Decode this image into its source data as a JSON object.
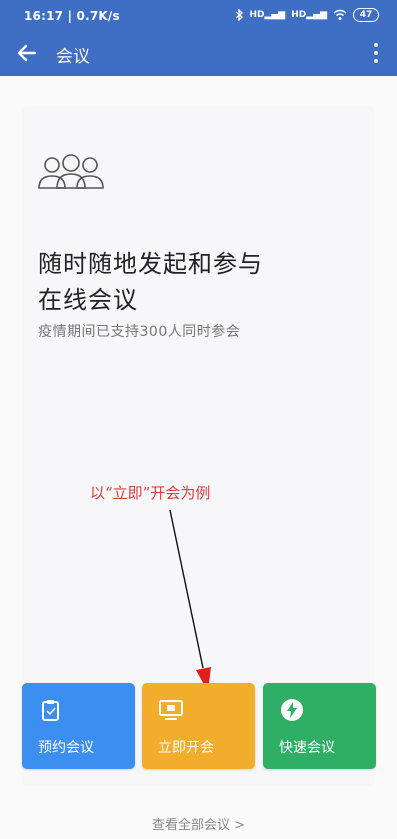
{
  "status_bar": {
    "time_speed": "16:17 | 0.7K/s",
    "signal1": "HD",
    "signal2": "HD",
    "battery": "47"
  },
  "app_bar": {
    "title": "会议"
  },
  "hero": {
    "headline_line1": "随时随地发起和参与",
    "headline_line2": "在线会议",
    "subline": "疫情期间已支持300人同时参会"
  },
  "annotation": {
    "text": "以“立即”开会为例",
    "color": "#e23b3b"
  },
  "actions": [
    {
      "label": "预约会议",
      "icon": "calendar-clipboard-icon",
      "color": "#3b8ff0"
    },
    {
      "label": "立即开会",
      "icon": "monitor-icon",
      "color": "#f3ad2c"
    },
    {
      "label": "快速会议",
      "icon": "lightning-icon",
      "color": "#2fae65"
    }
  ],
  "footer": {
    "view_all": "查看全部会议 >"
  },
  "colors": {
    "header": "#3f6fc4"
  }
}
